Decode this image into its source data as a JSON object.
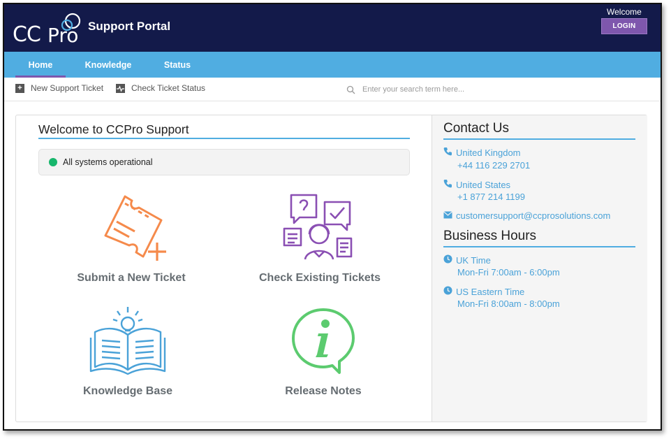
{
  "header": {
    "logo_cc": "CC",
    "logo_pro": "Pro",
    "portal_title": "Support Portal",
    "welcome": "Welcome",
    "login_label": "LOGIN",
    "brand_navy": "#131a4a",
    "accent_purple": "#7e57ad"
  },
  "nav": {
    "tabs": [
      {
        "label": "Home",
        "active": true
      },
      {
        "label": "Knowledge",
        "active": false
      },
      {
        "label": "Status",
        "active": false
      }
    ],
    "color": "#50ade1"
  },
  "toolbar": {
    "new_ticket": {
      "label": "New Support Ticket",
      "icon": "plus-icon"
    },
    "check_status": {
      "label": "Check Ticket Status",
      "icon": "pulse-icon"
    },
    "search_placeholder": "Enter your search term here..."
  },
  "main": {
    "title": "Welcome to CCPro Support",
    "status": {
      "text": "All systems operational",
      "color": "#17b66c"
    },
    "tiles": [
      {
        "label": "Submit a New Ticket",
        "icon": "ticket-plus-icon",
        "color": "#f58a4b"
      },
      {
        "label": "Check Existing Tickets",
        "icon": "support-agent-icon",
        "color": "#8a4fb3"
      },
      {
        "label": "Knowledge Base",
        "icon": "book-lightbulb-icon",
        "color": "#4aa2d8"
      },
      {
        "label": "Release Notes",
        "icon": "info-bubble-icon",
        "color": "#5ccb6f"
      }
    ]
  },
  "sidebar": {
    "contact_title": "Contact Us",
    "contacts": [
      {
        "region": "United Kingdom",
        "phone": "+44 116 229 2701",
        "icon": "phone-icon"
      },
      {
        "region": "United States",
        "phone": "+1 877 214 1199",
        "icon": "phone-icon"
      }
    ],
    "email": {
      "address": "customersupport@ccprosolutions.com",
      "icon": "envelope-icon"
    },
    "hours_title": "Business Hours",
    "hours": [
      {
        "zone": "UK Time",
        "hours": "Mon-Fri 7:00am - 6:00pm",
        "icon": "clock-icon"
      },
      {
        "zone": "US Eastern Time",
        "hours": "Mon-Fri 8:00am - 8:00pm",
        "icon": "clock-icon"
      }
    ]
  }
}
